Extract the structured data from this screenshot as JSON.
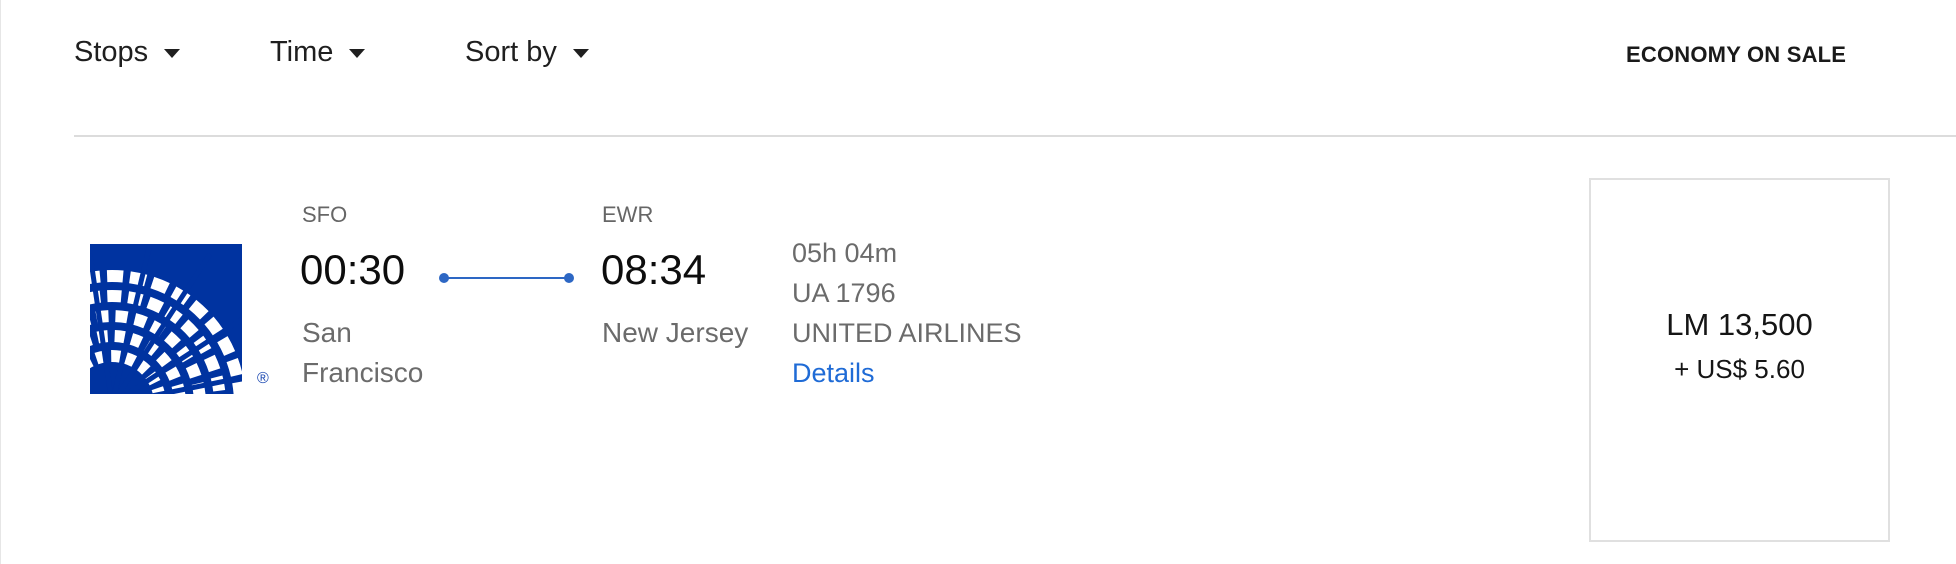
{
  "filters": {
    "stops": "Stops",
    "time": "Time",
    "sort": "Sort by"
  },
  "fare_header": "ECONOMY ON SALE",
  "flight": {
    "departure": {
      "code": "SFO",
      "time": "00:30",
      "city": "San Francisco"
    },
    "arrival": {
      "code": "EWR",
      "time": "08:34",
      "city": "New Jersey"
    },
    "duration": "05h 04m",
    "flight_number": "UA 1796",
    "airline": "UNITED AIRLINES",
    "details_link": "Details",
    "logo": {
      "icon": "united-globe-logo",
      "registered_mark": "®",
      "color": "#0033A0"
    }
  },
  "fare": {
    "miles": "LM 13,500",
    "taxes": "+ US$ 5.60"
  },
  "colors": {
    "accent": "#2d67c4",
    "link": "#1f6bd6",
    "brand": "#0033A0"
  }
}
